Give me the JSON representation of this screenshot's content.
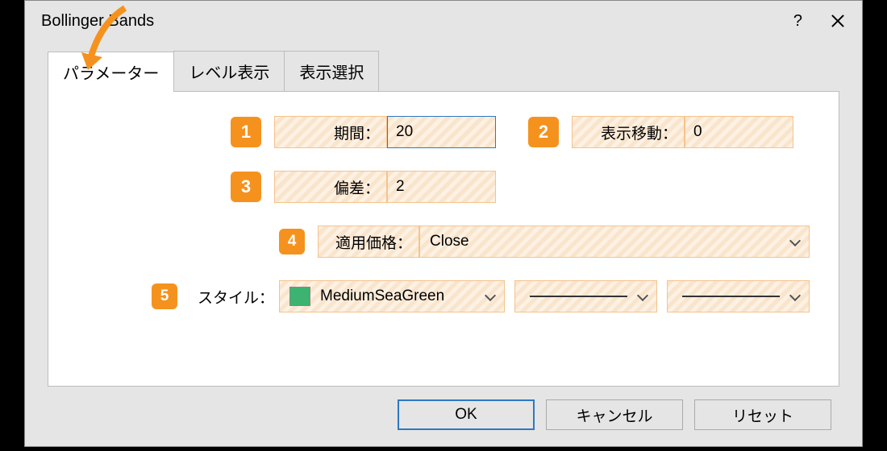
{
  "title": "Bollinger Bands",
  "tabs": {
    "t0": "パラメーター",
    "t1": "レベル表示",
    "t2": "表示選択"
  },
  "badges": {
    "b1": "1",
    "b2": "2",
    "b3": "3",
    "b4": "4",
    "b5": "5"
  },
  "labels": {
    "period": "期間：",
    "shift": "表示移動：",
    "deviation": "偏差：",
    "apply": "適用価格：",
    "style": "スタイル："
  },
  "values": {
    "period": "20",
    "shift": "0",
    "deviation": "2",
    "apply": "Close",
    "colorName": "MediumSeaGreen"
  },
  "buttons": {
    "ok": "OK",
    "cancel": "キャンセル",
    "reset": "リセット"
  },
  "help": "?"
}
